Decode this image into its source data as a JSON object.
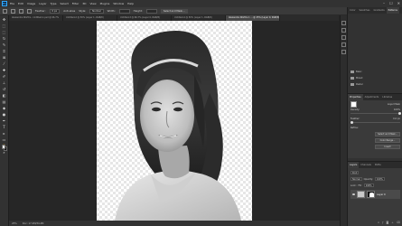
{
  "menubar": {
    "logo": "Ps",
    "items": [
      "File",
      "Edit",
      "Image",
      "Layer",
      "Type",
      "Select",
      "Filter",
      "3D",
      "View",
      "Plugins",
      "Window",
      "Help"
    ],
    "controls": [
      "–",
      "☐",
      "✕"
    ]
  },
  "options": {
    "feather_label": "Feather:",
    "feather_value": "0 px",
    "antialias_label": "Anti-alias",
    "style_label": "Style:",
    "style_value": "Normal",
    "width_label": "Width:",
    "height_label": "Height:",
    "select_button": "Select and Mask..."
  },
  "tabs": [
    {
      "label": "Alexandra Worths - Untitled-1.psd @ 66.7%",
      "active": false
    },
    {
      "label": "Untitled-2 @ 50% (Layer 1, RGB/8)",
      "active": false
    },
    {
      "label": "Untitled-3 @ 66.7% (Layer 0, RGB/8)",
      "active": false
    },
    {
      "label": "Untitled-4 @ 50% (Layer 1, RGB/8)",
      "active": false
    },
    {
      "label": "Alexandra Worths 1 ... @ 25% (Layer 0, RGB/8)",
      "active": true
    }
  ],
  "status": {
    "zoom": "25%",
    "doc": "Doc: 17.2M/34.4M"
  },
  "panels": {
    "top_tabs": [
      "Color",
      "Swatches",
      "Gradients",
      "Patterns"
    ],
    "library_items": [
      "Basic",
      "Mixed",
      "Pastel"
    ],
    "properties": {
      "tabs": [
        "Properties",
        "Adjustments",
        "Libraries"
      ],
      "title": "Layer Mask",
      "density_label": "Density:",
      "density_value": "100%",
      "feather_label": "Feather:",
      "feather_value": "0.0 px",
      "refine_label": "Refine:",
      "select_mask_btn": "Select and Mask...",
      "color_range_btn": "Color Range...",
      "invert_btn": "Invert"
    },
    "layers": {
      "tabs": [
        "Layers",
        "Channels",
        "Paths"
      ],
      "kind_label": "Kind",
      "blend_mode": "Normal",
      "opacity_label": "Opacity:",
      "opacity_value": "100%",
      "lock_label": "Lock:",
      "fill_label": "Fill:",
      "fill_value": "100%",
      "layer_name": "Layer 0"
    }
  },
  "colors": {
    "ui_dark": "#262626",
    "panel": "#323232",
    "accent": "#31a8ff"
  }
}
